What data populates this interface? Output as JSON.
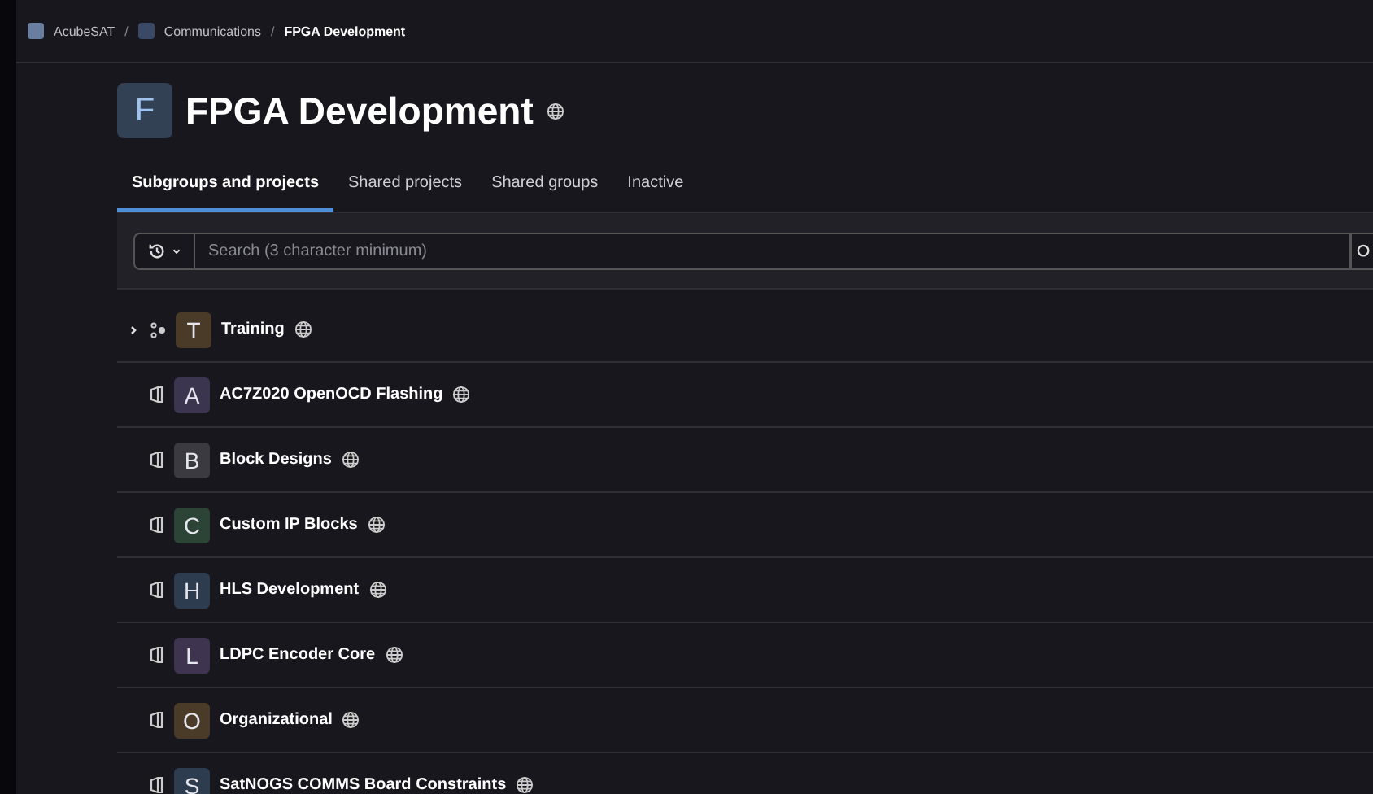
{
  "breadcrumbs": [
    {
      "label": "AcubeSAT",
      "current": false
    },
    {
      "label": "Communications",
      "current": false
    },
    {
      "label": "FPGA Development",
      "current": true
    }
  ],
  "breadcrumb_separator": "/",
  "group": {
    "avatar": "F",
    "title": "FPGA Development"
  },
  "tabs": [
    {
      "label": "Subgroups and projects",
      "selected": true
    },
    {
      "label": "Shared projects",
      "selected": false
    },
    {
      "label": "Shared groups",
      "selected": false
    },
    {
      "label": "Inactive",
      "selected": false
    }
  ],
  "search": {
    "placeholder": "Search (3 character minimum)"
  },
  "items": [
    {
      "kind": "group",
      "avatar": "T",
      "name": "Training",
      "color": "#4a3b28",
      "expanded": false
    },
    {
      "kind": "project",
      "avatar": "A",
      "name": "AC7Z020 OpenOCD Flashing",
      "color": "#3b3550"
    },
    {
      "kind": "project",
      "avatar": "B",
      "name": "Block Designs",
      "color": "#3a3a40"
    },
    {
      "kind": "project",
      "avatar": "C",
      "name": "Custom IP Blocks",
      "color": "#2c4436"
    },
    {
      "kind": "project",
      "avatar": "H",
      "name": "HLS Development",
      "color": "#2e3c50"
    },
    {
      "kind": "project",
      "avatar": "L",
      "name": "LDPC Encoder Core",
      "color": "#3e3450"
    },
    {
      "kind": "project",
      "avatar": "O",
      "name": "Organizational",
      "color": "#4a3b28"
    },
    {
      "kind": "project",
      "avatar": "S",
      "name": "SatNOGS COMMS Board Constraints",
      "color": "#2e3c50"
    }
  ]
}
